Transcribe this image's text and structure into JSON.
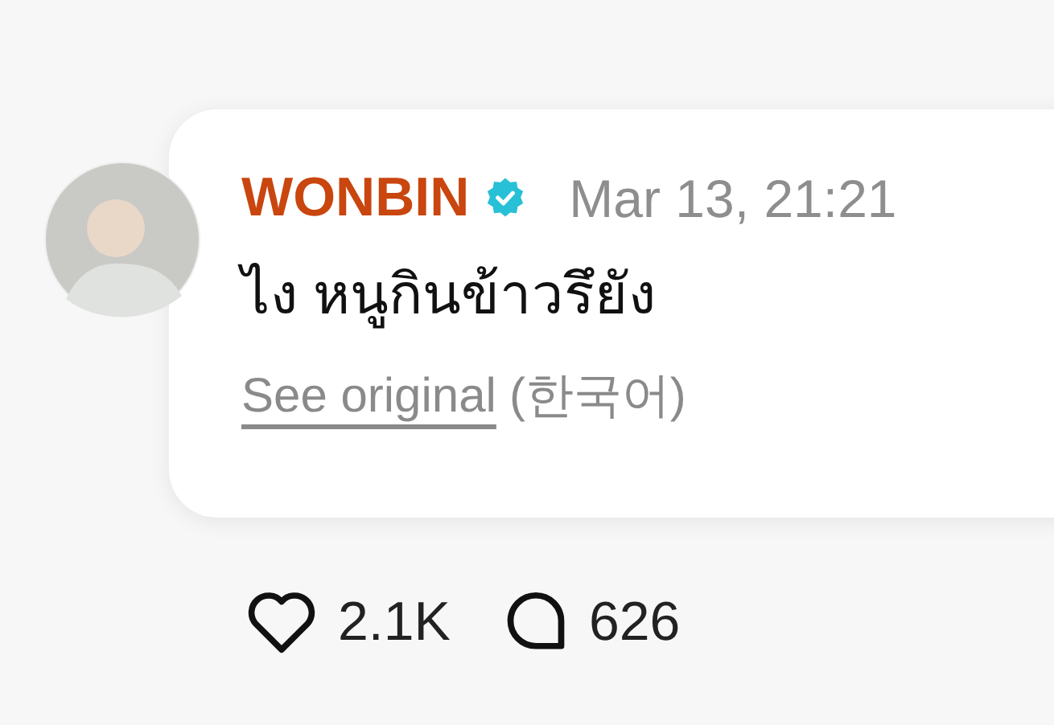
{
  "post": {
    "author": "WONBIN",
    "verified": true,
    "timestamp": "Mar 13, 21:21",
    "text": "ไง หนูกินข้าวรึยัง",
    "see_original": "See original",
    "language": "(한국어)"
  },
  "actions": [
    {
      "kind": "like",
      "count": "2.1K"
    },
    {
      "kind": "comment",
      "count": "626"
    }
  ]
}
